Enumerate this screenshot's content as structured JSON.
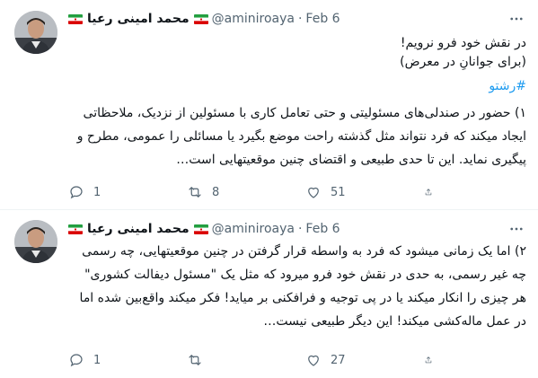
{
  "colors": {
    "accent": "#1d9bf0",
    "text": "#0f1419",
    "muted": "#536471",
    "divider": "#eff3f4"
  },
  "tweets": [
    {
      "author_name": "محمد امینی رعیا",
      "handle": "@aminiroaya",
      "separator": "·",
      "date": "Feb 6",
      "more_icon": "more-horizontal-icon",
      "lines": [
        "در نقش خود فرو نرویم!",
        "(برای جوانانِ در معرض)"
      ],
      "hashtag": "#رشتو",
      "paragraph": "۱) حضور در صندلی‌های مسئولیتی و حتی تعامل کاری با مسئولین از نزدیک، ملاحظاتی ایجاد میکند که فرد نتواند مثل گذشته راحت موضع بگیرد یا مسائلی را عمومی، مطرح و پیگیری نماید. این تا حدی طبیعی و اقتضای چنین موقعیتهایی است…",
      "actions": {
        "reply_count": "1",
        "retweet_count": "8",
        "like_count": "51"
      }
    },
    {
      "author_name": "محمد امینی رعیا",
      "handle": "@aminiroaya",
      "separator": "·",
      "date": "Feb 6",
      "more_icon": "more-horizontal-icon",
      "paragraph": "۲) اما یک زمانی میشود که فرد به واسطه قرار گرفتن در چنین موقعیتهایی، چه رسمی چه غیر رسمی، به حدی در نقش خود فرو میرود که مثل یک \"مسئول دیفالت کشوری\" هر چیزی را انکار میکند یا در پی توجیه و فرافکنی بر میاید! فکر میکند واقع‌بین شده اما در عمل ماله‌کشی میکند! این دیگر طبیعی نیست…",
      "actions": {
        "reply_count": "1",
        "retweet_count": "",
        "like_count": "27"
      }
    }
  ]
}
